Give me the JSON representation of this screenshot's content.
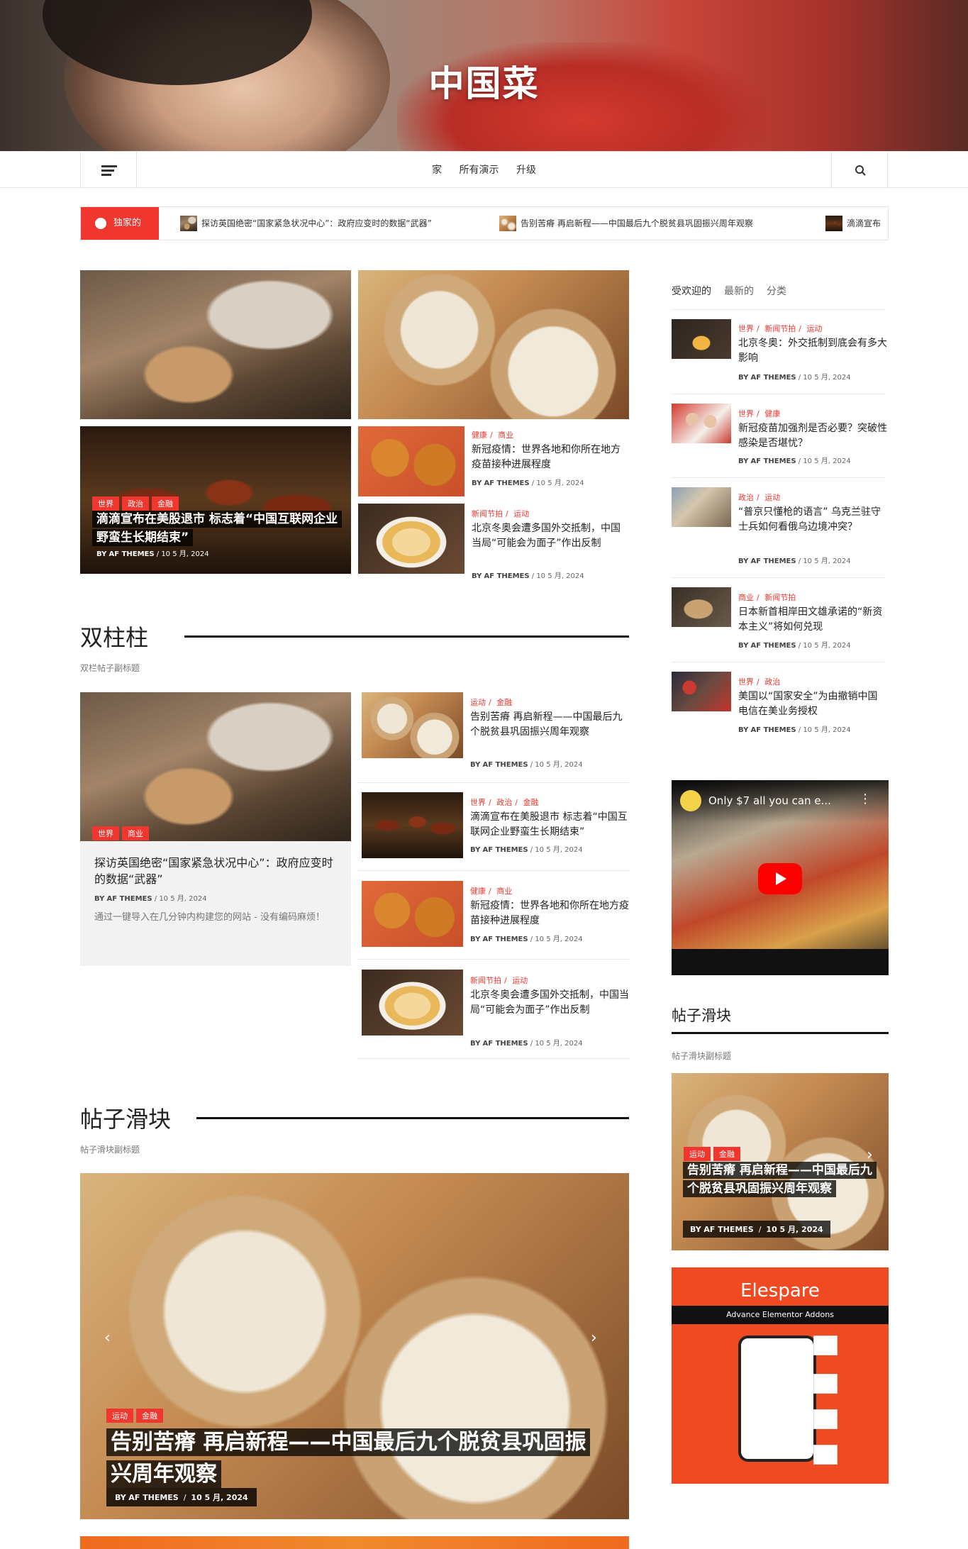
{
  "hero": {
    "title": "中国菜"
  },
  "nav": {
    "items": [
      "家",
      "所有演示",
      "升级"
    ]
  },
  "ticker": {
    "badge": "独家的",
    "items": [
      "探访英国绝密“国家紧急状况中心”：政府应变时的数据“武器”",
      "告别苦瘠 再启新程——中国最后九个脱贫县巩固振兴周年观察",
      "滴滴宣布"
    ]
  },
  "grid": {
    "big": {
      "cats": [
        "世界",
        "政治",
        "金融"
      ],
      "title": "滴滴宣布在美股退市 标志着“中国互联网企业野蛮生长期结束”",
      "meta_by": "BY",
      "meta_author": "AF THEMES",
      "meta_sep": "/",
      "meta_date": "10 5 月, 2024"
    },
    "small1": {
      "cats": [
        "健康",
        "商业"
      ],
      "title": "新冠疫情：世界各地和你所在地方疫苗接种进展程度",
      "meta_by": "BY",
      "meta_author": "AF THEMES",
      "meta_date": "10 5 月, 2024"
    },
    "small2": {
      "cats": [
        "新闻节拍",
        "运动"
      ],
      "title": "北京冬奥会遭多国外交抵制，中国当局“可能会为面子”作出反制",
      "meta_by": "BY",
      "meta_author": "AF THEMES",
      "meta_date": "10 5 月, 2024"
    }
  },
  "sidebar": {
    "tabs": [
      "受欢迎的",
      "最新的",
      "分类"
    ],
    "posts": [
      {
        "cats": [
          "世界",
          "新闻节拍",
          "运动"
        ],
        "title": "北京冬奥：外交抵制到底会有多大影响",
        "author": "AF THEMES",
        "date": "10 5 月, 2024"
      },
      {
        "cats": [
          "世界",
          "健康"
        ],
        "title": "新冠疫苗加强剂是否必要？突破性感染是否堪忧？",
        "author": "AF THEMES",
        "date": "10 5 月, 2024"
      },
      {
        "cats": [
          "政治",
          "运动"
        ],
        "title": "“普京只懂枪的语言” 乌克兰驻守士兵如何看俄乌边境冲突？",
        "author": "AF THEMES",
        "date": "10 5 月, 2024"
      },
      {
        "cats": [
          "商业",
          "新闻节拍"
        ],
        "title": "日本新首相岸田文雄承诺的“新资本主义”将如何兑现",
        "author": "AF THEMES",
        "date": "10 5 月, 2024"
      },
      {
        "cats": [
          "世界",
          "政治"
        ],
        "title": "美国以“国家安全”为由撤销中国电信在美业务授权",
        "author": "AF THEMES",
        "date": "10 5 月, 2024"
      }
    ],
    "video": {
      "title": "Only $7 all you can e..."
    },
    "slider_title": "帖子滑块",
    "slider_sub": "帖子滑块副标题",
    "slide": {
      "cats": [
        "运动",
        "金融"
      ],
      "title": "告别苦瘠 再启新程——中国最后九个脱贫县巩固振兴周年观察",
      "author": "AF THEMES",
      "date": "10 5 月, 2024"
    },
    "ad": {
      "brand": "Elespare",
      "tag": "Advance Elementor Addons"
    }
  },
  "twocol": {
    "title": "双柱柱",
    "sub": "双栏帖子副标题",
    "main": {
      "cats": [
        "世界",
        "商业"
      ],
      "title": "探访英国绝密“国家紧急状况中心”：政府应变时的数据“武器”",
      "author": "AF THEMES",
      "date": "10 5 月, 2024",
      "excerpt": "通过一键导入在几分钟内构建您的网站 - 没有编码麻烦！"
    },
    "list": [
      {
        "cats": [
          "运动",
          "金融"
        ],
        "title": "告别苦瘠 再启新程——中国最后九个脱贫县巩固振兴周年观察",
        "author": "AF THEMES",
        "date": "10 5 月, 2024"
      },
      {
        "cats": [
          "世界",
          "政治",
          "金融"
        ],
        "title": "滴滴宣布在美股退市 标志着“中国互联网企业野蛮生长期结束”",
        "author": "AF THEMES",
        "date": "10 5 月, 2024"
      },
      {
        "cats": [
          "健康",
          "商业"
        ],
        "title": "新冠疫情：世界各地和你所在地方疫苗接种进展程度",
        "author": "AF THEMES",
        "date": "10 5 月, 2024"
      },
      {
        "cats": [
          "新闻节拍",
          "运动"
        ],
        "title": "北京冬奥会遭多国外交抵制，中国当局“可能会为面子”作出反制",
        "author": "AF THEMES",
        "date": "10 5 月, 2024"
      }
    ]
  },
  "slider": {
    "title": "帖子滑块",
    "sub": "帖子滑块副标题",
    "slide": {
      "cats": [
        "运动",
        "金融"
      ],
      "title": "告别苦瘠 再启新程——中国最后九个脱贫县巩固振兴周年观察",
      "author": "AF THEMES",
      "date": "10 5 月, 2024"
    }
  },
  "colors": {
    "accent": "#f0372f"
  }
}
